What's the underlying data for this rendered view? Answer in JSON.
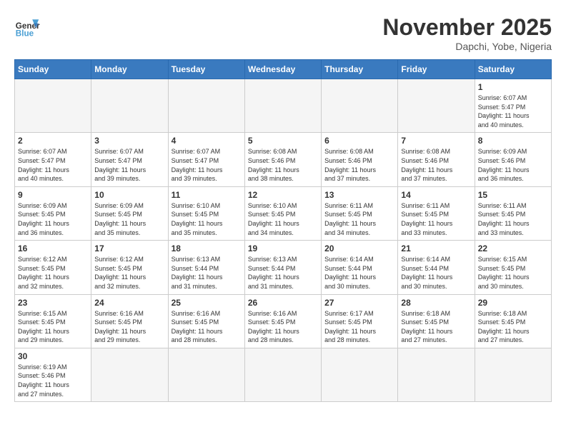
{
  "header": {
    "logo_general": "General",
    "logo_blue": "Blue",
    "title": "November 2025",
    "subtitle": "Dapchi, Yobe, Nigeria"
  },
  "days_of_week": [
    "Sunday",
    "Monday",
    "Tuesday",
    "Wednesday",
    "Thursday",
    "Friday",
    "Saturday"
  ],
  "weeks": [
    [
      {
        "day": "",
        "info": ""
      },
      {
        "day": "",
        "info": ""
      },
      {
        "day": "",
        "info": ""
      },
      {
        "day": "",
        "info": ""
      },
      {
        "day": "",
        "info": ""
      },
      {
        "day": "",
        "info": ""
      },
      {
        "day": "1",
        "info": "Sunrise: 6:07 AM\nSunset: 5:47 PM\nDaylight: 11 hours\nand 40 minutes."
      }
    ],
    [
      {
        "day": "2",
        "info": "Sunrise: 6:07 AM\nSunset: 5:47 PM\nDaylight: 11 hours\nand 40 minutes."
      },
      {
        "day": "3",
        "info": "Sunrise: 6:07 AM\nSunset: 5:47 PM\nDaylight: 11 hours\nand 39 minutes."
      },
      {
        "day": "4",
        "info": "Sunrise: 6:07 AM\nSunset: 5:47 PM\nDaylight: 11 hours\nand 39 minutes."
      },
      {
        "day": "5",
        "info": "Sunrise: 6:08 AM\nSunset: 5:46 PM\nDaylight: 11 hours\nand 38 minutes."
      },
      {
        "day": "6",
        "info": "Sunrise: 6:08 AM\nSunset: 5:46 PM\nDaylight: 11 hours\nand 37 minutes."
      },
      {
        "day": "7",
        "info": "Sunrise: 6:08 AM\nSunset: 5:46 PM\nDaylight: 11 hours\nand 37 minutes."
      },
      {
        "day": "8",
        "info": "Sunrise: 6:09 AM\nSunset: 5:46 PM\nDaylight: 11 hours\nand 36 minutes."
      }
    ],
    [
      {
        "day": "9",
        "info": "Sunrise: 6:09 AM\nSunset: 5:45 PM\nDaylight: 11 hours\nand 36 minutes."
      },
      {
        "day": "10",
        "info": "Sunrise: 6:09 AM\nSunset: 5:45 PM\nDaylight: 11 hours\nand 35 minutes."
      },
      {
        "day": "11",
        "info": "Sunrise: 6:10 AM\nSunset: 5:45 PM\nDaylight: 11 hours\nand 35 minutes."
      },
      {
        "day": "12",
        "info": "Sunrise: 6:10 AM\nSunset: 5:45 PM\nDaylight: 11 hours\nand 34 minutes."
      },
      {
        "day": "13",
        "info": "Sunrise: 6:11 AM\nSunset: 5:45 PM\nDaylight: 11 hours\nand 34 minutes."
      },
      {
        "day": "14",
        "info": "Sunrise: 6:11 AM\nSunset: 5:45 PM\nDaylight: 11 hours\nand 33 minutes."
      },
      {
        "day": "15",
        "info": "Sunrise: 6:11 AM\nSunset: 5:45 PM\nDaylight: 11 hours\nand 33 minutes."
      }
    ],
    [
      {
        "day": "16",
        "info": "Sunrise: 6:12 AM\nSunset: 5:45 PM\nDaylight: 11 hours\nand 32 minutes."
      },
      {
        "day": "17",
        "info": "Sunrise: 6:12 AM\nSunset: 5:45 PM\nDaylight: 11 hours\nand 32 minutes."
      },
      {
        "day": "18",
        "info": "Sunrise: 6:13 AM\nSunset: 5:44 PM\nDaylight: 11 hours\nand 31 minutes."
      },
      {
        "day": "19",
        "info": "Sunrise: 6:13 AM\nSunset: 5:44 PM\nDaylight: 11 hours\nand 31 minutes."
      },
      {
        "day": "20",
        "info": "Sunrise: 6:14 AM\nSunset: 5:44 PM\nDaylight: 11 hours\nand 30 minutes."
      },
      {
        "day": "21",
        "info": "Sunrise: 6:14 AM\nSunset: 5:44 PM\nDaylight: 11 hours\nand 30 minutes."
      },
      {
        "day": "22",
        "info": "Sunrise: 6:15 AM\nSunset: 5:45 PM\nDaylight: 11 hours\nand 30 minutes."
      }
    ],
    [
      {
        "day": "23",
        "info": "Sunrise: 6:15 AM\nSunset: 5:45 PM\nDaylight: 11 hours\nand 29 minutes."
      },
      {
        "day": "24",
        "info": "Sunrise: 6:16 AM\nSunset: 5:45 PM\nDaylight: 11 hours\nand 29 minutes."
      },
      {
        "day": "25",
        "info": "Sunrise: 6:16 AM\nSunset: 5:45 PM\nDaylight: 11 hours\nand 28 minutes."
      },
      {
        "day": "26",
        "info": "Sunrise: 6:16 AM\nSunset: 5:45 PM\nDaylight: 11 hours\nand 28 minutes."
      },
      {
        "day": "27",
        "info": "Sunrise: 6:17 AM\nSunset: 5:45 PM\nDaylight: 11 hours\nand 28 minutes."
      },
      {
        "day": "28",
        "info": "Sunrise: 6:18 AM\nSunset: 5:45 PM\nDaylight: 11 hours\nand 27 minutes."
      },
      {
        "day": "29",
        "info": "Sunrise: 6:18 AM\nSunset: 5:45 PM\nDaylight: 11 hours\nand 27 minutes."
      }
    ],
    [
      {
        "day": "30",
        "info": "Sunrise: 6:19 AM\nSunset: 5:46 PM\nDaylight: 11 hours\nand 27 minutes."
      },
      {
        "day": "",
        "info": ""
      },
      {
        "day": "",
        "info": ""
      },
      {
        "day": "",
        "info": ""
      },
      {
        "day": "",
        "info": ""
      },
      {
        "day": "",
        "info": ""
      },
      {
        "day": "",
        "info": ""
      }
    ]
  ]
}
